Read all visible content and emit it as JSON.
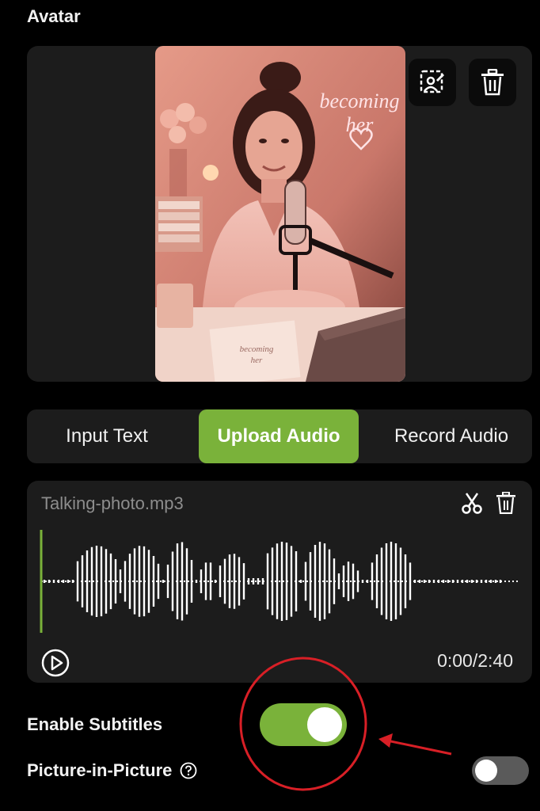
{
  "section": {
    "title": "Avatar"
  },
  "avatar": {
    "photo_neon_text_line1": "becoming",
    "photo_neon_text_line2": "her",
    "edit_icon": "replace-photo-icon",
    "delete_icon": "trash-icon"
  },
  "tabs": [
    {
      "label": "Input Text",
      "active": false
    },
    {
      "label": "Upload Audio",
      "active": true
    },
    {
      "label": "Record Audio",
      "active": false
    }
  ],
  "audio": {
    "filename": "Talking-photo.mp3",
    "time": "0:00/2:40",
    "icons": {
      "cut": "scissors-icon",
      "delete": "trash-icon",
      "play": "play-icon"
    }
  },
  "settings": {
    "enable_subtitles": {
      "label": "Enable Subtitles",
      "on": true
    },
    "picture_in_picture": {
      "label": "Picture-in-Picture",
      "help_icon": "help-circle-icon",
      "on": false
    }
  },
  "colors": {
    "accent": "#7ab23a",
    "panel": "#1c1c1c",
    "annotation": "#d81f26"
  }
}
